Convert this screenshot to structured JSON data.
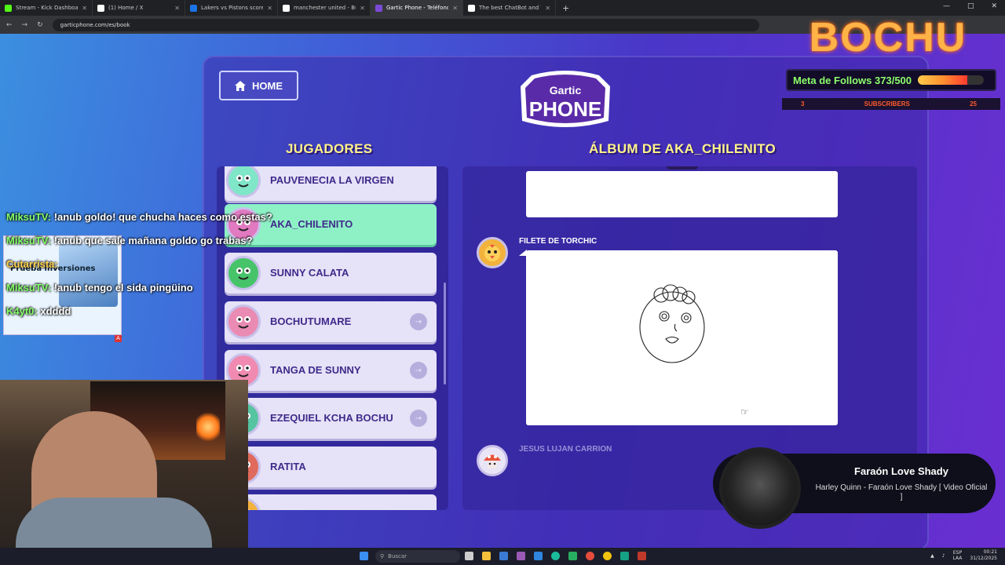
{
  "browser": {
    "tabs": [
      {
        "title": "Stream - Kick Dashboard",
        "color": "#53fc18"
      },
      {
        "title": "(1) Home / X",
        "color": "#ffffff"
      },
      {
        "title": "Lakers vs Pistons scores & pred",
        "color": "#1a73e8"
      },
      {
        "title": "manchester united - Buscar con",
        "color": "#ffffff"
      },
      {
        "title": "Gartic Phone - Teléfono Descon",
        "color": "#7b4bd8"
      },
      {
        "title": "The best ChatBot and Widg",
        "color": "#ffffff"
      }
    ],
    "url": "garticphone.com/es/book"
  },
  "game": {
    "home_label": "HOME",
    "logo_top": "Gartic",
    "logo_bottom": "PHONE",
    "players_title": "JUGADORES",
    "album_title": "ÁLBUM DE AKA_CHILENITO",
    "players": [
      {
        "name": "PAUVENECIA LA VIRGEN",
        "avatar_color": "#7fe6c8",
        "active": false,
        "kick": false
      },
      {
        "name": "AKA_CHILENITO",
        "avatar_color": "#e17ac0",
        "active": true,
        "kick": false
      },
      {
        "name": "SUNNY CALATA",
        "avatar_color": "#47c46a",
        "active": false,
        "kick": false
      },
      {
        "name": "BOCHUTUMARE",
        "avatar_color": "#e98bb2",
        "active": false,
        "kick": true
      },
      {
        "name": "TANGA DE SUNNY",
        "avatar_color": "#f08ab0",
        "active": false,
        "kick": true
      },
      {
        "name": "EZEQUIEL KCHA BOCHU",
        "avatar_color": "#56c4a0",
        "active": false,
        "kick": true
      },
      {
        "name": "RATITA",
        "avatar_color": "#e06a5b",
        "active": false,
        "kick": false
      },
      {
        "name": "FILETE DE TORCHIC",
        "avatar_color": "#f2b23c",
        "active": false,
        "kick": false
      }
    ],
    "album": {
      "entry1_author": "FILETE DE TORCHIC",
      "entry2_author": "JESUS LUJAN CARRION"
    }
  },
  "chat": [
    {
      "user": "MiksuTV:",
      "msg": "!anub goldo! que chucha haces como estas?",
      "color": "green"
    },
    {
      "user": "MiksuTV:",
      "msg": "!anub que sale mañana goldo go trabas?",
      "color": "green"
    },
    {
      "user": "Cutarrista:",
      "msg": "",
      "color": "yellow"
    },
    {
      "user": "MiksuTV:",
      "msg": "!anub tengo el sida pingüino",
      "color": "green"
    },
    {
      "user": "K4yt0:",
      "msg": "xdddd",
      "color": "green"
    }
  ],
  "ad": {
    "text": "Prueba inversiones"
  },
  "stream": {
    "brand": "BOCHU",
    "follows_label": "Meta de Follows 373/500",
    "follows_progress": 0.746,
    "subs_left": "3",
    "subs_label": "SUBSCRIBERS",
    "subs_right": "25"
  },
  "music": {
    "title": "Faraón Love Shady",
    "subtitle": "Harley Quinn - Faraón Love Shady [ Video Oficial ]"
  },
  "taskbar": {
    "search_placeholder": "Buscar",
    "lang1": "ESP",
    "lang2": "LAA",
    "time": "00:21",
    "date": "31/12/2025"
  }
}
